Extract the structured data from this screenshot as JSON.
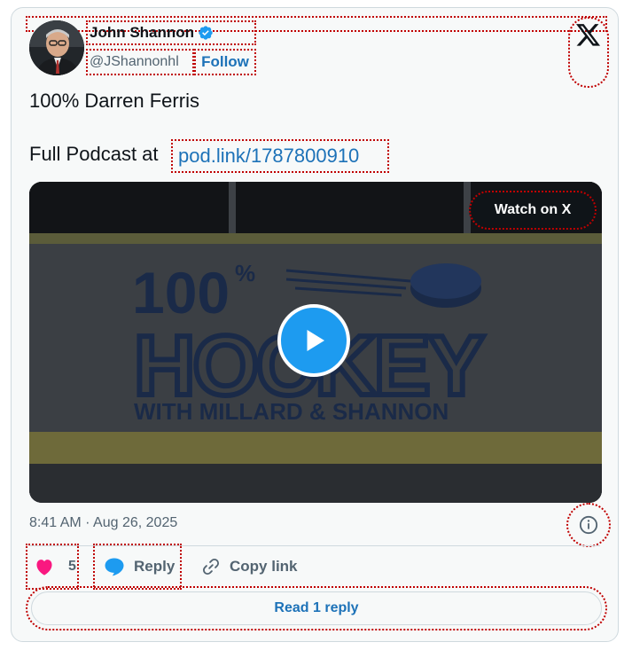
{
  "author": {
    "name": "John Shannon",
    "handle": "@JShannonhl",
    "follow_label": "Follow",
    "verified_icon": "verified-badge-icon"
  },
  "post": {
    "line1": "100% Darren Ferris",
    "line2_prefix": "Full Podcast at ",
    "link_text": "pod.link/1787800910"
  },
  "media": {
    "watch_label": "Watch on X",
    "graphic_line1": "100",
    "graphic_percent": "%",
    "graphic_line2": "HOCKEY",
    "graphic_line3": "WITH MILLARD & SHANNON"
  },
  "meta": {
    "timestamp": "8:41 AM · Aug 26, 2025"
  },
  "actions": {
    "like_count": "5",
    "reply_label": "Reply",
    "copy_label": "Copy link",
    "read_replies_label": "Read 1 reply"
  },
  "colors": {
    "accent": "#1d9bf0",
    "link": "#1d72b8",
    "like": "#f91880",
    "text_secondary": "#536471"
  }
}
